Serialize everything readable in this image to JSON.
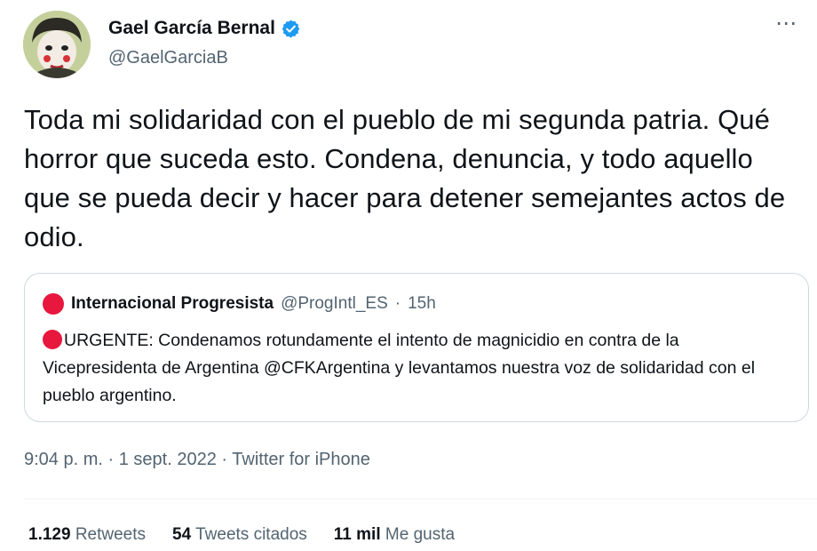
{
  "author": {
    "name": "Gael García Bernal",
    "handle": "@GaelGarciaB",
    "verified": true,
    "more_icon": "⋯"
  },
  "tweet": {
    "text": "Toda mi solidaridad con el pueblo de mi segunda patria. Qué horror que suceda esto. Condena, denuncia, y todo aquello que se pueda decir y hacer para detener semejantes actos de odio."
  },
  "quote": {
    "name": "Internacional Progresista",
    "handle": "@ProgIntl_ES",
    "separator": "·",
    "time": "15h",
    "text": "URGENTE: Condenamos rotundamente el intento de magnicidio en contra de la Vicepresidenta de Argentina @CFKArgentina y levantamos nuestra voz de solidaridad con el pueblo argentino."
  },
  "meta": {
    "time": "9:04 p. m.",
    "separator": "·",
    "date": "1 sept. 2022",
    "source": "Twitter for iPhone"
  },
  "stats": {
    "retweets_count": "1.129",
    "retweets_label": "Retweets",
    "quotes_count": "54",
    "quotes_label": "Tweets citados",
    "likes_count": "11 mil",
    "likes_label": "Me gusta"
  },
  "colors": {
    "verified": "#1d9bf0",
    "secondary_text": "#536471",
    "quote_avatar": "#e8173e"
  }
}
